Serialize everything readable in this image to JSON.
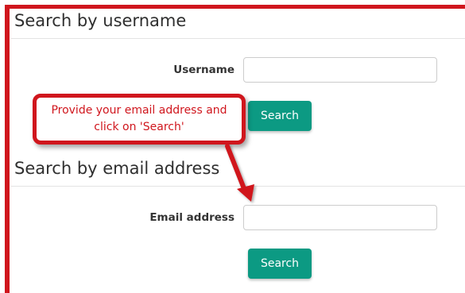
{
  "username_section": {
    "heading": "Search by username",
    "label": "Username",
    "input_value": "",
    "input_placeholder": "",
    "button_label": "Search"
  },
  "email_section": {
    "heading": "Search by email address",
    "label": "Email address",
    "input_value": "",
    "input_placeholder": "",
    "button_label": "Search"
  },
  "callout": {
    "text": "Provide your email address and click on 'Search'"
  },
  "colors": {
    "highlight": "#d0161d",
    "button": "#0c9a83",
    "heading_text": "#2f2f2f"
  },
  "icons": {
    "arrow": "red-arrow-pointing-to-email-field"
  }
}
